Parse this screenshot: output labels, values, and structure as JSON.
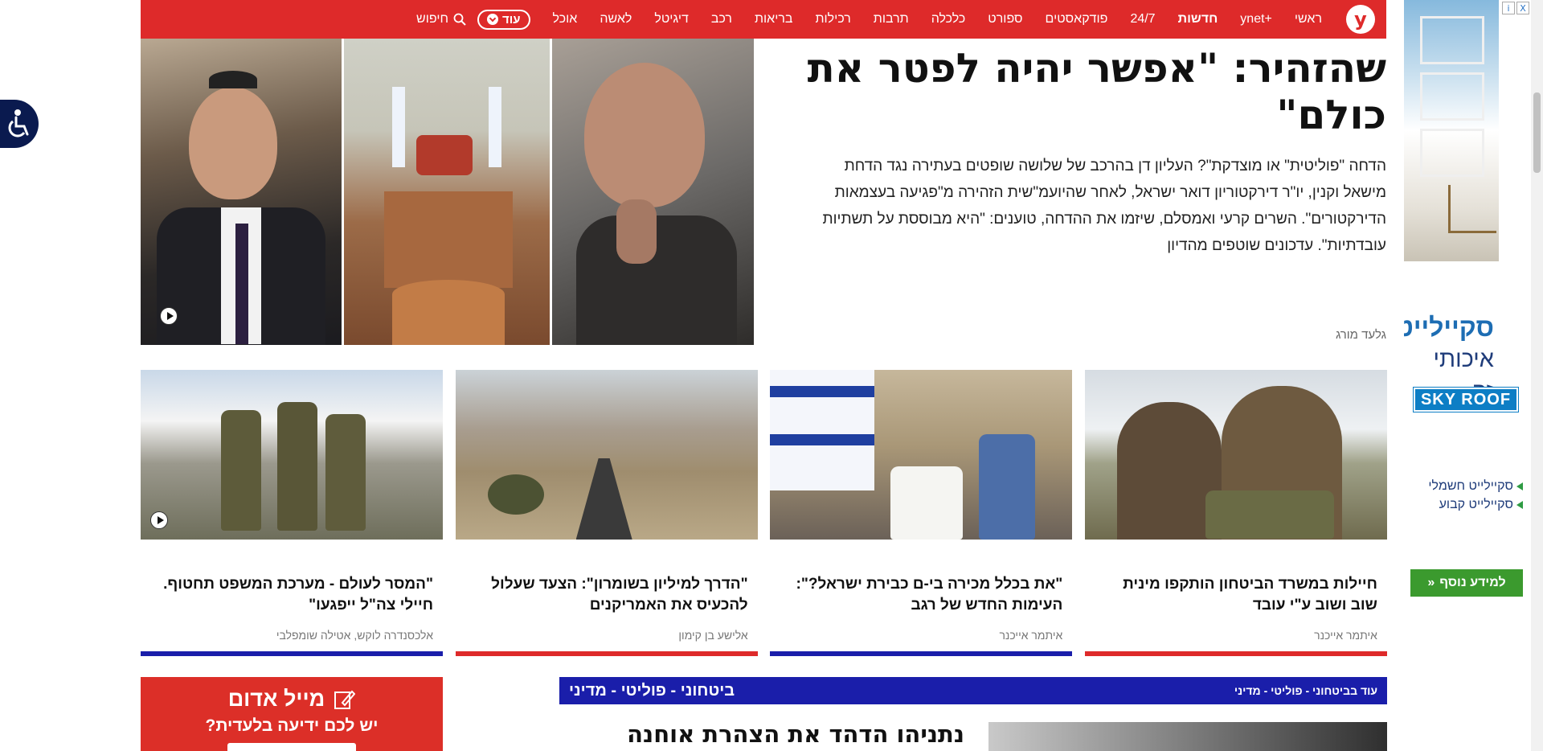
{
  "nav": {
    "logo": "y",
    "items": [
      "ראשי",
      "+ynet",
      "חדשות",
      "24/7",
      "פודקאסטים",
      "ספורט",
      "כלכלה",
      "תרבות",
      "רכילות",
      "בריאות",
      "רכב",
      "דיגיטל",
      "לאשה",
      "אוכל"
    ],
    "more_label": "עוד",
    "search_label": "חיפוש"
  },
  "hero": {
    "title": "שהזהיר: \"אפשר יהיה לפטר את כולם\"",
    "subtitle": "הדחה \"פוליטית\" או מוצדקת\"? העליון דן בהרכב של שלושה שופטים בעתירה נגד הדחת מישאל וקנין, יו\"ר דירקטוריון דואר ישראל, לאחר שהיועמ\"שית הזהירה מ\"פגיעה בעצמאות הדירקטורים\". השרים קרעי ואמסלם, שיזמו את ההדחה, טוענים: \"היא מבוססת על תשתיות עובדתיות\". עדכונים שוטפים מהדיון",
    "author": "גלעד מורג"
  },
  "cards": [
    {
      "title": "חיילות במשרד הביטחון הותקפו מינית שוב ושוב ע\"י עובד",
      "author": "איתמר אייכנר",
      "bar_color": "#de2a2a"
    },
    {
      "title": "\"את בכלל מכירה בי-ם כבירת ישראל?\": העימות החדש של רגב",
      "author": "איתמר אייכנר",
      "bar_color": "#1a1eaa"
    },
    {
      "title": "\"הדרך למיליון בשומרון\": הצעד שעלול להכעיס את האמריקנים",
      "author": "אלישע בן קימון",
      "bar_color": "#de2a2a"
    },
    {
      "title": "\"המסר לעולם - מערכת המשפט תחטוף. חיילי צה\"ל ייפגעו\"",
      "author": "אלכסנדרה לוקש, אטילה שומפלבי",
      "bar_color": "#1a1eaa"
    }
  ],
  "section": {
    "title": "ביטחוני - פוליטי - מדיני",
    "more": "עוד בביטחוני - פוליטי - מדיני",
    "headline": "נתניהו הדהד את הצהרת אוחנה"
  },
  "red_mail": {
    "title": "מייל אדום",
    "subtitle": "יש לכם ידיעה בלעדית?"
  },
  "ad": {
    "brand": "סקיילייט",
    "brand_sub": "איכותי זה",
    "logo": "SKY ROOF",
    "links": [
      "סקיילייט חשמלי",
      "סקיילייט קבוע"
    ],
    "cta": "למידע נוסף",
    "badge_info": "i",
    "badge_close": "X"
  },
  "colors": {
    "brand_red": "#de2a2a",
    "section_blue": "#1a1eaa"
  }
}
